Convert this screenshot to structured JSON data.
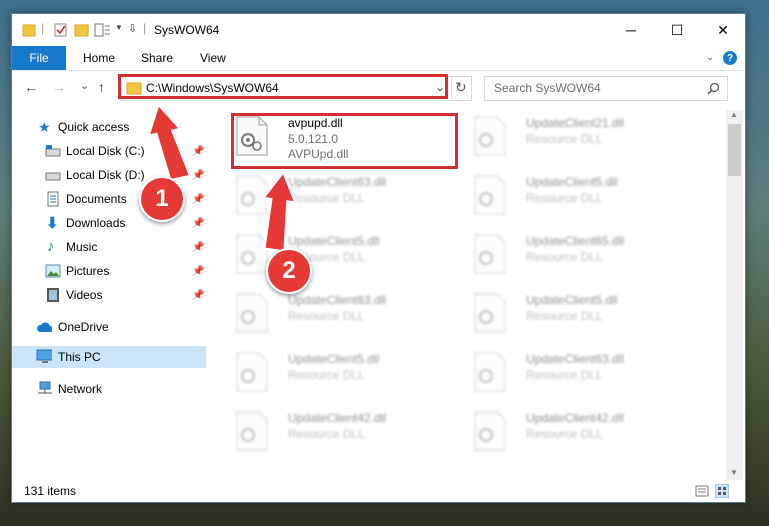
{
  "window": {
    "title": "SysWOW64",
    "controls": {
      "minimize": "─",
      "maximize": "☐",
      "close": "✕"
    }
  },
  "ribbon": {
    "tabs": [
      {
        "label": "File"
      },
      {
        "label": "Home"
      },
      {
        "label": "Share"
      },
      {
        "label": "View"
      }
    ],
    "help": "?"
  },
  "navigation": {
    "back": "←",
    "forward": "→",
    "recent": "⌄",
    "up": "↑",
    "address": "C:\\Windows\\SysWOW64",
    "search_placeholder": "Search SysWOW64"
  },
  "sidebar": {
    "items": [
      {
        "label": "Quick access",
        "icon": "star-icon"
      },
      {
        "label": "Local Disk (C:)",
        "icon": "drive-icon",
        "pinned": true
      },
      {
        "label": "Local Disk (D:)",
        "icon": "drive-icon",
        "pinned": true
      },
      {
        "label": "Documents",
        "icon": "document-icon",
        "pinned": true
      },
      {
        "label": "Downloads",
        "icon": "download-icon",
        "pinned": true
      },
      {
        "label": "Music",
        "icon": "music-icon",
        "pinned": true
      },
      {
        "label": "Pictures",
        "icon": "picture-icon",
        "pinned": true
      },
      {
        "label": "Videos",
        "icon": "video-icon",
        "pinned": true
      },
      {
        "label": "OneDrive",
        "icon": "cloud-icon"
      },
      {
        "label": "This PC",
        "icon": "computer-icon",
        "selected": true
      },
      {
        "label": "Network",
        "icon": "network-icon"
      }
    ]
  },
  "files": {
    "selected": {
      "name": "avpupd.dll",
      "version": "5.0.121.0",
      "description": "AVPUpd.dll"
    },
    "left": [
      {
        "name": "UpdateClient63.dll",
        "type": "Resource DLL"
      },
      {
        "name": "UpdateClient5.dll",
        "type": "Resource DLL"
      },
      {
        "name": "UpdateClient63.dll",
        "type": "Resource DLL"
      },
      {
        "name": "UpdateClient5.dll",
        "type": "Resource DLL"
      },
      {
        "name": "UpdateClient42.dll",
        "type": "Resource DLL"
      }
    ],
    "right": [
      {
        "name": "UpdateClient21.dll",
        "type": "Resource DLL"
      },
      {
        "name": "UpdateClient5.dll",
        "type": "Resource DLL"
      },
      {
        "name": "UpdateClient65.dll",
        "type": "Resource DLL"
      },
      {
        "name": "UpdateClient5.dll",
        "type": "Resource DLL"
      },
      {
        "name": "UpdateClient63.dll",
        "type": "Resource DLL"
      },
      {
        "name": "UpdateClient42.dll",
        "type": "Resource DLL"
      }
    ]
  },
  "status": {
    "items_count": "131 items"
  },
  "annotations": {
    "step1": "1",
    "step2": "2",
    "color": "#e53935"
  }
}
